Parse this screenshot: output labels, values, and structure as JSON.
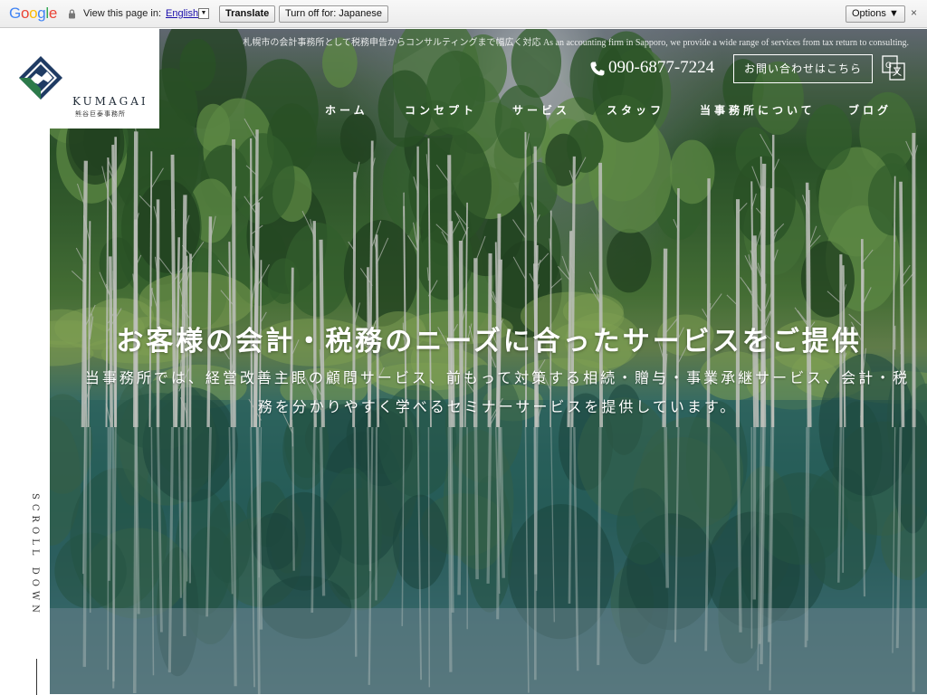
{
  "translate_bar": {
    "brand": "Google",
    "brand_colors": [
      "#4285F4",
      "#EA4335",
      "#FBBC05",
      "#4285F4",
      "#34A853",
      "#EA4335"
    ],
    "view_text": "View this page in:",
    "language": "English",
    "language_arrow": "▼",
    "translate_label": "Translate",
    "turn_off_label": "Turn off for: Japanese",
    "options_label": "Options ▼",
    "close_glyph": "×"
  },
  "header": {
    "logo_name": "KUMAGAI",
    "logo_sub": "熊谷巨泰事務所",
    "tagline": "札幌市の会計事務所として税務申告からコンサルティングまで幅広く対応 As an accounting firm in Sapporo, we provide a wide range of services from tax return to consulting.",
    "phone": "090-6877-7224",
    "contact_label": "お問い合わせはこちら",
    "nav": [
      {
        "label": "ホーム"
      },
      {
        "label": "コンセプト"
      },
      {
        "label": "サービス"
      },
      {
        "label": "スタッフ"
      },
      {
        "label": "当事務所について"
      },
      {
        "label": "ブログ"
      }
    ]
  },
  "hero": {
    "title": "お客様の会計・税務のニーズに合ったサービスをご提供",
    "description": "当事務所では、経営改善主眼の顧問サービス、前もって対策する相続・贈与・事業承継サービス、会計・税務を分かりやすく学べるセミナーサービスを提供しています。"
  },
  "scroll_label": "SCROLL DOWN",
  "colors": {
    "logo_blue": "#1f3b63",
    "logo_green": "#2c7a4a"
  }
}
